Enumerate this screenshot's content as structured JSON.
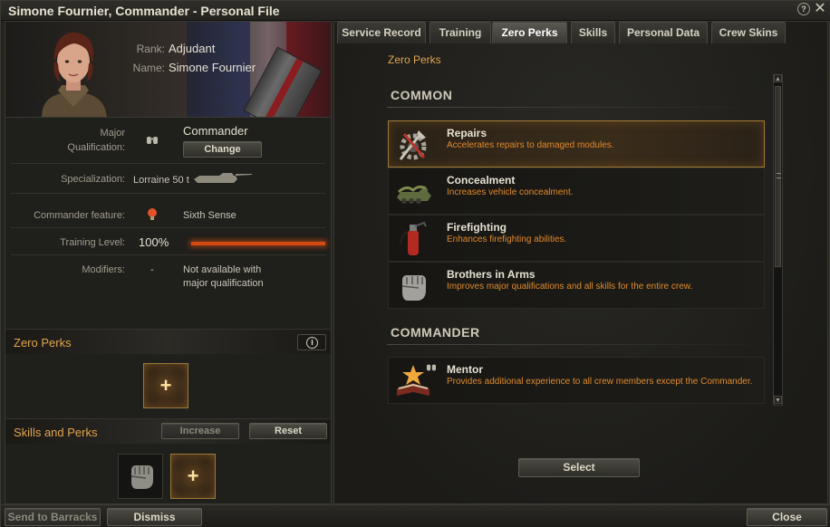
{
  "window": {
    "title": "Simone Fournier, Commander - Personal File"
  },
  "profile": {
    "rank_label": "Rank:",
    "rank": "Adjudant",
    "name_label": "Name:",
    "name": "Simone Fournier"
  },
  "details": {
    "major_label_1": "Major",
    "major_label_2": "Qualification:",
    "major_value": "Commander",
    "change_label": "Change",
    "specialization_label": "Specialization:",
    "specialization_value": "Lorraine 50 t",
    "feature_label": "Commander feature:",
    "feature_value": "Sixth Sense",
    "training_label": "Training Level:",
    "training_value": "100%",
    "training_fraction": 1.0,
    "modifiers_label": "Modifiers:",
    "modifiers_dash": "-",
    "modifiers_value_1": "Not available with",
    "modifiers_value_2": "major qualification"
  },
  "zero_perks_section": {
    "title": "Zero Perks",
    "plus": "+"
  },
  "skills_section": {
    "title": "Skills and Perks",
    "increase_label": "Increase",
    "reset_label": "Reset",
    "plus": "+"
  },
  "bottom": {
    "send_label": "Send to Barracks",
    "dismiss_label": "Dismiss",
    "close_label": "Close"
  },
  "tabs": [
    {
      "label": "Service Record"
    },
    {
      "label": "Training"
    },
    {
      "label": "Zero Perks"
    },
    {
      "label": "Skills"
    },
    {
      "label": "Personal Data"
    },
    {
      "label": "Crew Skins"
    }
  ],
  "active_tab": "Zero Perks",
  "right": {
    "title": "Zero Perks",
    "categories": [
      {
        "title": "COMMON"
      },
      {
        "title": "COMMANDER"
      }
    ],
    "perks": [
      {
        "name": "Repairs",
        "desc": "Accelerates repairs to damaged modules.",
        "icon": "repairs-icon",
        "selected": true
      },
      {
        "name": "Concealment",
        "desc": "Increases vehicle concealment.",
        "icon": "concealment-icon",
        "selected": false
      },
      {
        "name": "Firefighting",
        "desc": "Enhances firefighting abilities.",
        "icon": "firefighting-icon",
        "selected": false
      },
      {
        "name": "Brothers in Arms",
        "desc": "Improves major qualifications and all skills for the entire crew.",
        "icon": "brothers-in-arms-icon",
        "selected": false
      },
      {
        "name": "Mentor",
        "desc": "Provides additional experience to all crew members except the Commander.",
        "icon": "mentor-icon",
        "selected": false
      }
    ],
    "select_label": "Select"
  },
  "colors": {
    "accent": "#e2a54c",
    "desc": "#e08a2c",
    "training_bar": "#d44a12"
  }
}
